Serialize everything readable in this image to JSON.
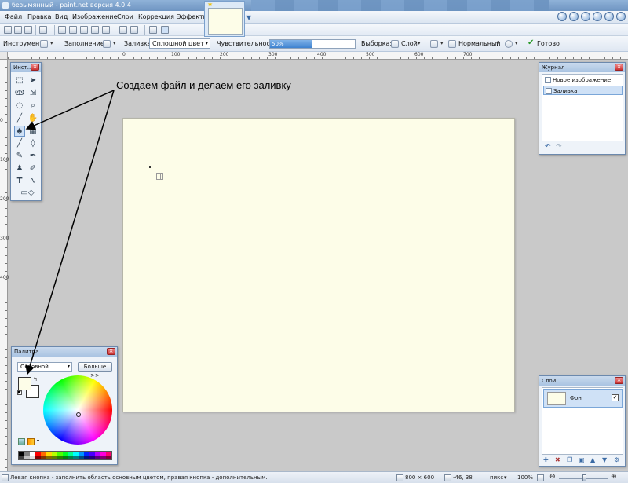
{
  "window": {
    "title": "безымянный - paint.net версия 4.0.4"
  },
  "menu": [
    "Файл",
    "Правка",
    "Вид",
    "Изображение",
    "Слои",
    "Коррекция",
    "Эффекты"
  ],
  "options": {
    "tool_label": "Инструмент:",
    "fill_mode_label": "Заполнение:",
    "fill_label": "Заливка:",
    "fill_value": "Сплошной цвет",
    "sensitivity_label": "Чувствительность:",
    "sensitivity_value": "50%",
    "sensitivity_fraction": 0.5,
    "selection_label": "Выборка:",
    "selection_value": "Слой",
    "blend_value": "Нормальный",
    "done_label": "Готово"
  },
  "rulers": {
    "top": [
      "0",
      "100",
      "200",
      "300",
      "400",
      "500",
      "600",
      "700"
    ],
    "left": [
      "0",
      "100",
      "200",
      "300",
      "400"
    ]
  },
  "tools_panel": {
    "title": "Инст..."
  },
  "palette_panel": {
    "title": "Палитра",
    "mode_value": "Основной",
    "more_label": "Больше >>",
    "primary_color": "#fdfde8",
    "secondary_color": "#ffffff"
  },
  "history_panel": {
    "title": "Журнал",
    "items": [
      "Новое изображение",
      "Заливка"
    ]
  },
  "layers_panel": {
    "title": "Слои",
    "layer_name": "Фон",
    "layer_visible": "✓"
  },
  "annotation": {
    "text": "Создаем файл и делаем его заливку"
  },
  "status": {
    "hint": "Левая кнопка - заполнить область основным цветом, правая кнопка - дополнительным.",
    "image_size": "800 × 600",
    "cursor_pos": "-46, 38",
    "units": "пикс",
    "zoom": "100%"
  },
  "colors": {
    "canvas": "#fdfde8",
    "accent": "#3d82d0"
  },
  "icons": {
    "tools": [
      "rectangle-select-icon",
      "move-selection-icon",
      "lasso-icon",
      "move-selected-icon",
      "ellipse-select-icon",
      "zoom-icon",
      "magic-wand-icon",
      "pan-icon",
      "paint-bucket-icon",
      "gradient-icon",
      "paintbrush-icon",
      "eraser-icon",
      "pencil-icon",
      "color-picker-icon",
      "clone-stamp-icon",
      "recolor-icon",
      "text-icon",
      "line-curve-icon",
      "shapes-icon"
    ]
  }
}
